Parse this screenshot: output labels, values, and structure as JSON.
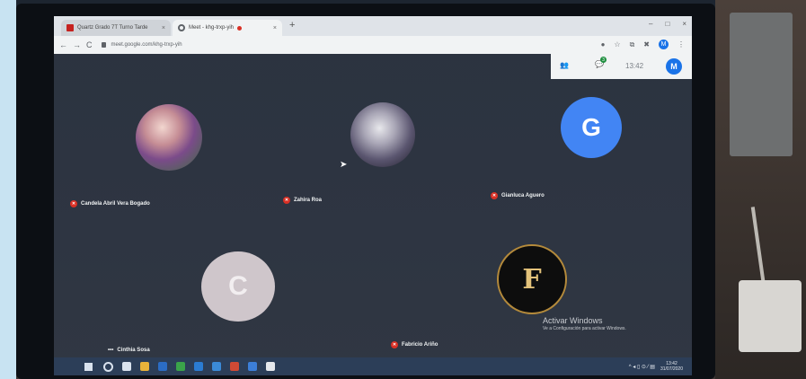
{
  "browser": {
    "tab1_title": "Quartz Grado 7T Turno Tarde",
    "tab2_title": "Meet - khg-trxp-yih",
    "tab_close": "×",
    "new_tab": "+",
    "url": "meet.google.com/khg-trxp-yih",
    "window_controls": [
      "–",
      "□",
      "×"
    ],
    "nav_back": "←",
    "nav_forward": "→",
    "reload": "C",
    "profile_initial": "M"
  },
  "meet_panel": {
    "people_icon": "people-icon",
    "chat_badge": "3",
    "time": "13:42",
    "avatar_initial": "M"
  },
  "participants": [
    {
      "name": "Candela Abril Vera Bogado",
      "avatar": "photo"
    },
    {
      "name": "Zahira Roa",
      "avatar": "photo"
    },
    {
      "name": "Gianluca Aguero",
      "avatar": "G",
      "color": "#4285f4"
    },
    {
      "name": "Cinthia Sosa",
      "avatar": "C",
      "color": "#cfc6cb"
    },
    {
      "name": "Fabricio Ariño",
      "avatar": "F",
      "color": "#0d0d0d"
    }
  ],
  "watermark": {
    "line1": "Activar Windows",
    "line2": "Ve a Configuración para activar Windows."
  },
  "taskbar": {
    "clock_time": "13:42",
    "clock_date": "31/07/2020",
    "tray_icons": "^ ◂ ▯ ⊙ ⁄ ▤"
  }
}
